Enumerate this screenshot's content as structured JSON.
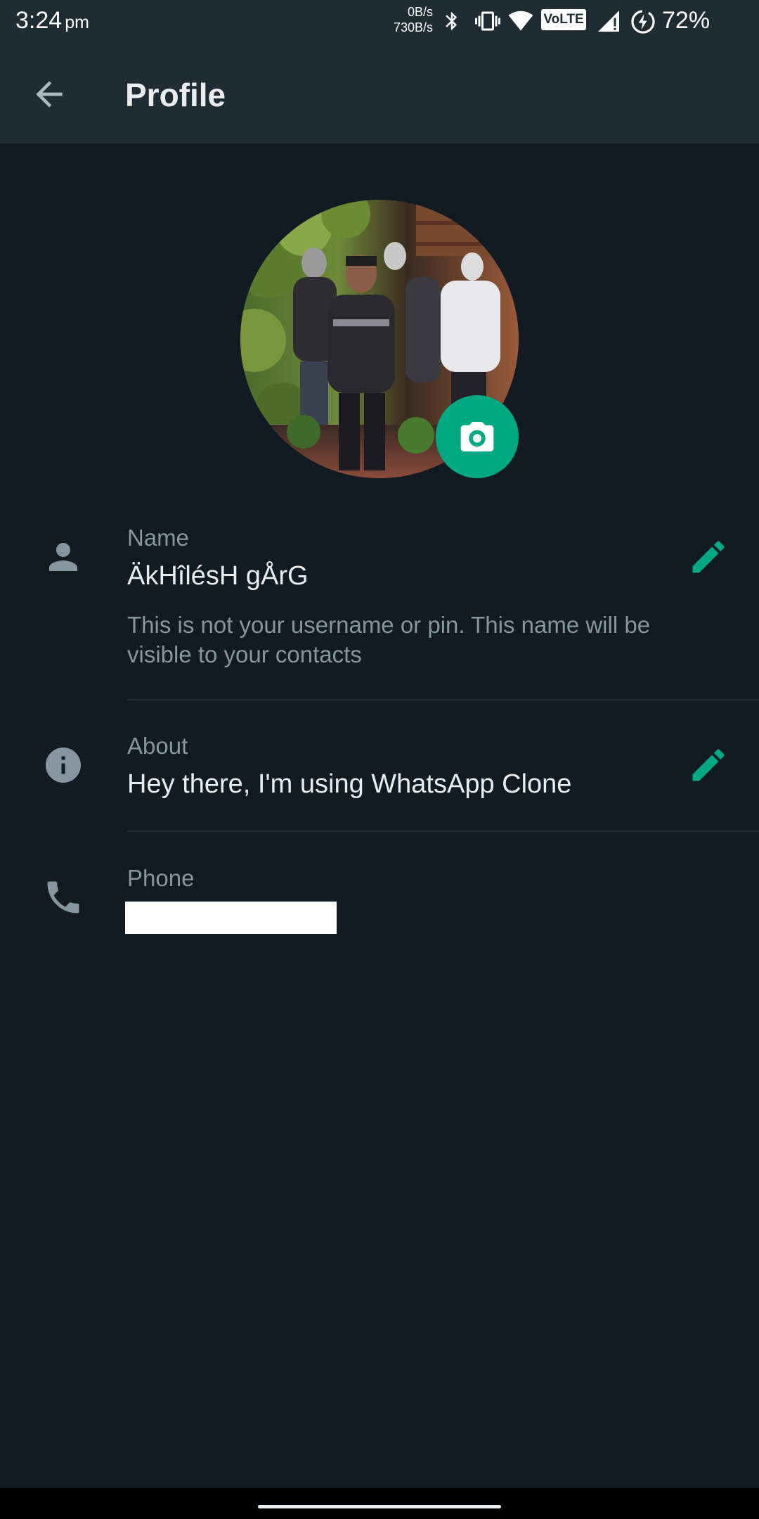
{
  "status_bar": {
    "time": "3:24",
    "ampm": "pm",
    "net_up": "0B/s",
    "net_down": "730B/s",
    "volte": "VoLTE",
    "battery": "72%",
    "icons": [
      "bluetooth-icon",
      "vibrate-icon",
      "wifi-icon",
      "volte-icon",
      "signal-icon",
      "battery-charging-icon"
    ]
  },
  "app_bar": {
    "title": "Profile",
    "back_icon": "arrow-back-icon"
  },
  "profile": {
    "avatar_icon": "profile-photo",
    "camera_icon": "camera-icon",
    "accent_color": "#00a884"
  },
  "name_row": {
    "icon": "person-icon",
    "label": "Name",
    "value": "ÄkHîlésH gÅrG",
    "helper": "This is not your username or pin. This name will be visible to your contacts",
    "edit_icon": "pencil-icon"
  },
  "about_row": {
    "icon": "info-icon",
    "label": "About",
    "value": "Hey there, I'm using WhatsApp Clone",
    "edit_icon": "pencil-icon"
  },
  "phone_row": {
    "icon": "phone-icon",
    "label": "Phone",
    "value": ""
  },
  "colors": {
    "background": "#121b22",
    "app_bar": "#1f2c34",
    "primary_text": "#e9edef",
    "secondary_text": "#8696a0",
    "accent": "#00a884"
  }
}
